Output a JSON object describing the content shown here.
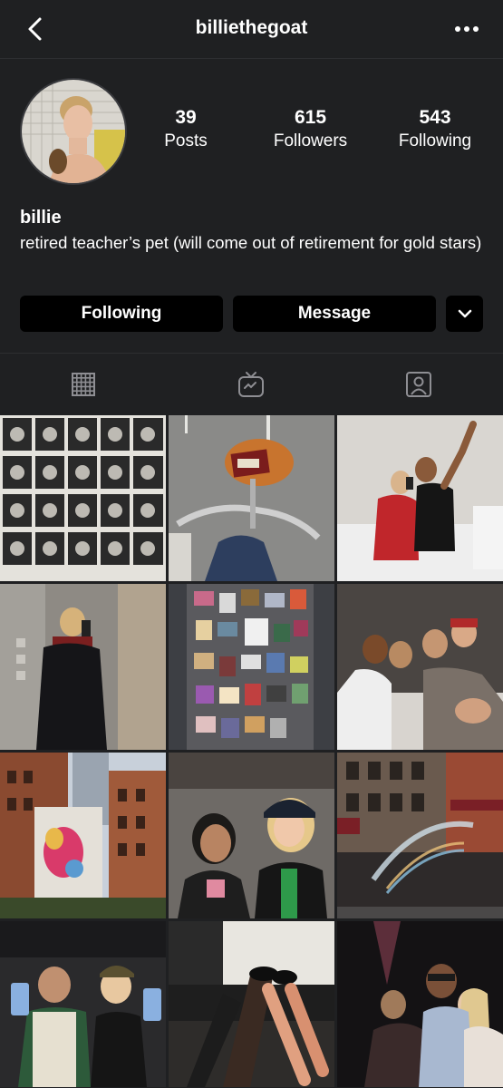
{
  "header": {
    "username": "billiethegoat",
    "back_icon": "chevron-left-icon",
    "menu_icon": "more-horizontal-icon"
  },
  "profile": {
    "display_name": "billie",
    "bio": "retired teacher’s pet (will come out of retirement for gold stars)",
    "stats": [
      {
        "value": "39",
        "label": "Posts"
      },
      {
        "value": "615",
        "label": "Followers"
      },
      {
        "value": "543",
        "label": "Following"
      }
    ]
  },
  "actions": {
    "following_label": "Following",
    "message_label": "Message",
    "suggest_icon": "chevron-down-icon"
  },
  "tabs": [
    {
      "icon": "grid-icon",
      "selected": true
    },
    {
      "icon": "igtv-icon",
      "selected": false
    },
    {
      "icon": "tagged-icon",
      "selected": false
    }
  ],
  "colors": {
    "background": "#1f2022",
    "button": "#000000",
    "divider": "#2d2e31",
    "tab_icon": "#8e8e93"
  },
  "posts": [
    "photo-booth-strips",
    "bike-basket-books",
    "couple-bedroom",
    "elevator-selfie",
    "fridge-photos",
    "friends-in-bed",
    "city-mural-buildings",
    "two-friends-selfie",
    "street-hydrant-rainbow",
    "friends-holding-phones",
    "feet-on-bed",
    "party-group"
  ]
}
